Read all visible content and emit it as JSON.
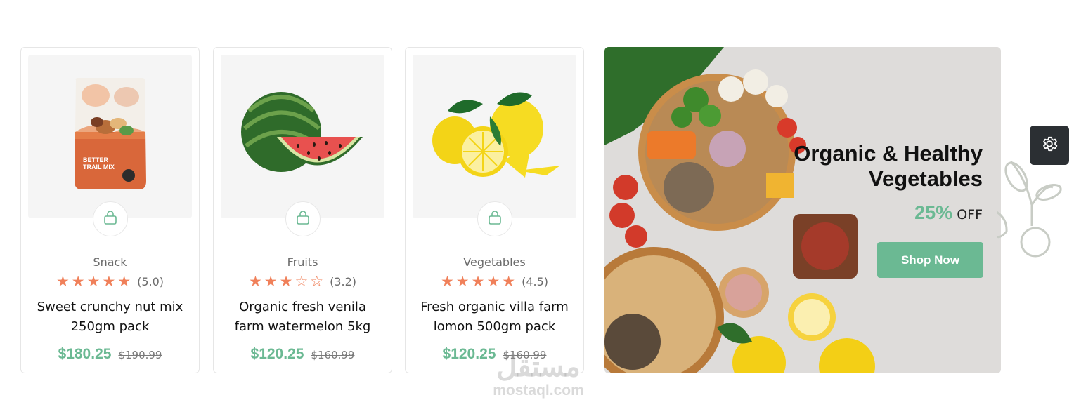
{
  "products": [
    {
      "image": "trail-mix-pouch",
      "category": "Snack",
      "rating": 5.0,
      "rating_label": "(5.0)",
      "title_line1": "Sweet crunchy nut mix",
      "title_line2": "250gm pack",
      "price": "$180.25",
      "old_price": "$190.99",
      "pouch_label": "BETTER TRAIL MIX"
    },
    {
      "image": "watermelon",
      "category": "Fruits",
      "rating": 3.2,
      "rating_label": "(3.2)",
      "title_line1": "Organic fresh venila",
      "title_line2": "farm watermelon 5kg",
      "price": "$120.25",
      "old_price": "$160.99"
    },
    {
      "image": "lemons",
      "category": "Vegetables",
      "rating": 4.5,
      "rating_label": "(4.5)",
      "title_line1": "Fresh organic villa farm",
      "title_line2": "lomon 500gm pack",
      "price": "$120.25",
      "old_price": "$160.99"
    }
  ],
  "banner": {
    "title_line1": "Organic & Healthy",
    "title_line2": "Vegetables",
    "discount": "25%",
    "discount_suffix": "OFF",
    "cta": "Shop Now"
  },
  "watermark": {
    "arabic": "مستقل",
    "latin": "mostaql.com"
  },
  "colors": {
    "accent": "#6bb993",
    "star": "#f0805a",
    "settings_bg": "#2b2f33"
  },
  "icons": {
    "cart": "lock-bag-icon",
    "settings": "gear-icon",
    "star": "star-icon"
  }
}
